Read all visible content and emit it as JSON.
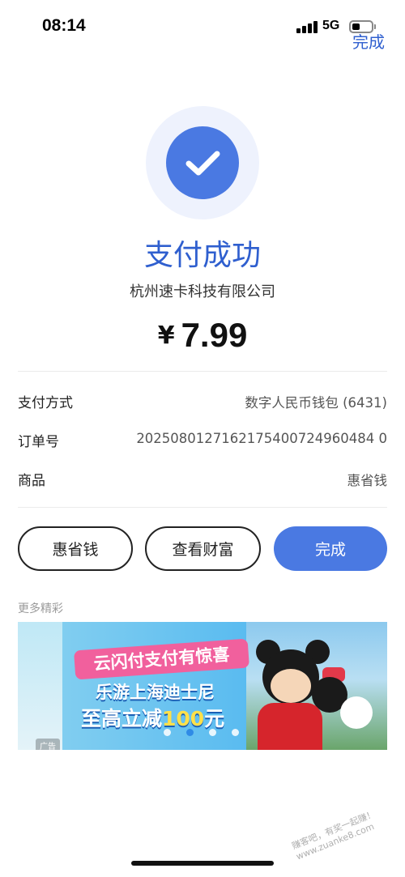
{
  "status_bar": {
    "time": "08:14",
    "network": "5G",
    "done_label": "完成"
  },
  "header": {
    "icon": "check-icon",
    "title": "支付成功",
    "merchant": "杭州速卡科技有限公司",
    "currency": "¥",
    "amount": "7.99"
  },
  "details": [
    {
      "key": "支付方式",
      "value": "数字人民币钱包 (6431)"
    },
    {
      "key": "订单号",
      "value": "2025080127162175400724960484 0"
    },
    {
      "key": "商品",
      "value": "惠省钱"
    }
  ],
  "buttons": {
    "left": "惠省钱",
    "middle": "查看财富",
    "primary": "完成"
  },
  "more": {
    "label": "更多精彩"
  },
  "banner": {
    "ribbon": "云闪付支付有惊喜",
    "line1": "乐游上海迪士尼",
    "line2_prefix": "至高立减",
    "line2_number": "100",
    "line2_suffix": "元",
    "ad_tag": "广告",
    "page_count": 4,
    "active_page": 2
  },
  "watermark": "赚客吧，有奖一起赚！ www.zuanke8.com",
  "colors": {
    "accent": "#4a79e2",
    "title": "#2f5fcf",
    "ribbon": "#f1609d"
  }
}
